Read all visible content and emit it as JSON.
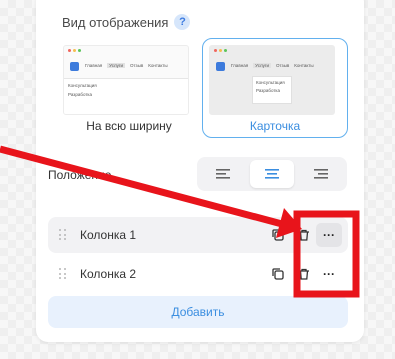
{
  "display": {
    "title": "Вид отображения",
    "help_glyph": "?",
    "options": [
      {
        "label": "На всю ширину",
        "selected": false,
        "preview_nav": [
          "Главная",
          "Услуги",
          "Отзыв",
          "Контакты"
        ],
        "preview_items": [
          "Консультация",
          "Разработка"
        ]
      },
      {
        "label": "Карточка",
        "selected": true,
        "preview_nav": [
          "Главная",
          "Услуги",
          "Отзыв",
          "Контакты"
        ],
        "preview_items": [
          "Консультация",
          "Разработка"
        ]
      }
    ]
  },
  "position": {
    "label": "Положение",
    "alignments": [
      "left",
      "center",
      "right"
    ],
    "active": "center"
  },
  "columns": [
    {
      "label": "Колонка 1",
      "more": "···"
    },
    {
      "label": "Колонка 2",
      "more": "···"
    }
  ],
  "add_label": "Добавить",
  "colors": {
    "accent": "#3b8ee0",
    "annotation": "#e8141b"
  },
  "icons": [
    "help-icon",
    "drag-handle-icon",
    "copy-icon",
    "trash-icon",
    "more-icon",
    "align-left-icon",
    "align-center-icon",
    "align-right-icon"
  ]
}
